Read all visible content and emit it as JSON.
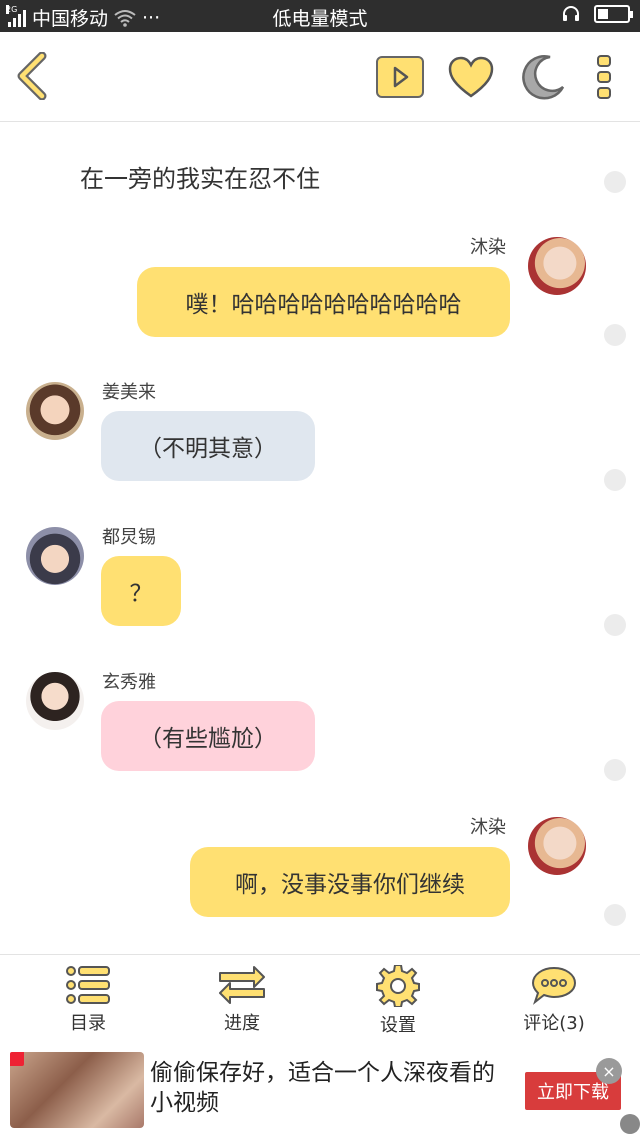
{
  "status_bar": {
    "network_type": "2G",
    "carrier": "中国移动",
    "more": "···",
    "mode": "低电量模式"
  },
  "top_nav": {
    "icons": [
      "back-icon",
      "play-icon",
      "heart-icon",
      "moon-icon",
      "more-icon"
    ]
  },
  "chat": {
    "narration": "在一旁的我实在忍不住",
    "messages": [
      {
        "sender": "沐染",
        "text": "噗！哈哈哈哈哈哈哈哈哈哈",
        "side": "right",
        "color": "#ffe072"
      },
      {
        "sender": "姜美来",
        "text": "（不明其意）",
        "side": "left",
        "color": "#e0e7ef"
      },
      {
        "sender": "都炅锡",
        "text": "？",
        "side": "left",
        "color": "#ffe072"
      },
      {
        "sender": "玄秀雅",
        "text": "（有些尴尬）",
        "side": "left",
        "color": "#ffd2db"
      },
      {
        "sender": "沐染",
        "text": "啊，没事没事你们继续",
        "side": "right",
        "color": "#ffe072"
      }
    ]
  },
  "toolbar": {
    "items": [
      {
        "label": "目录",
        "icon": "list-icon"
      },
      {
        "label": "进度",
        "icon": "swap-icon"
      },
      {
        "label": "设置",
        "icon": "gear-icon"
      },
      {
        "label": "评论(3)",
        "icon": "comment-icon"
      }
    ]
  },
  "ad": {
    "text": "偷偷保存好，适合一个人深夜看的小视频",
    "cta": "立即下载",
    "close": "×"
  },
  "colors": {
    "accent": "#ffe072",
    "icon_fill": "#ffe072",
    "icon_stroke": "#666666",
    "status_bar": "#2e2e2e",
    "cta": "#d83c3c"
  }
}
